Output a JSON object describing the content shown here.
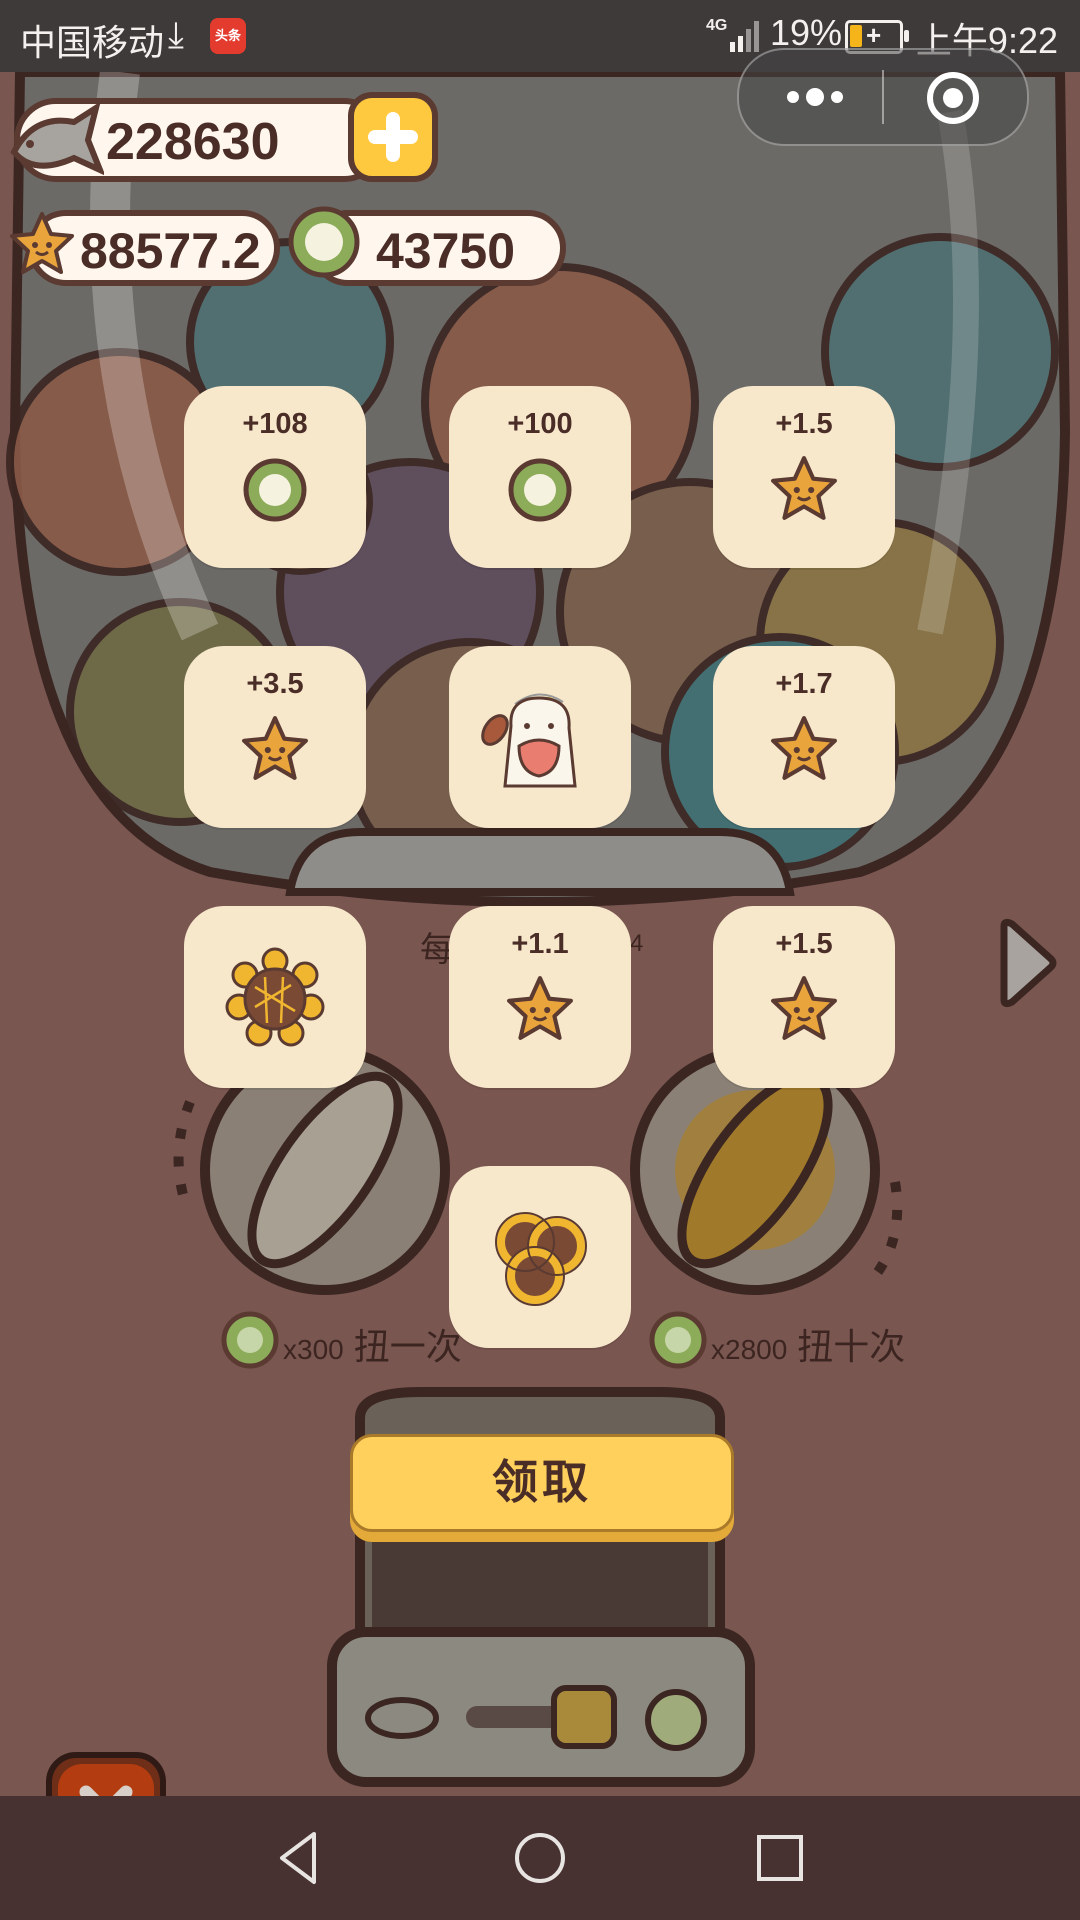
{
  "status_bar": {
    "carrier": "中国移动",
    "network": "4G",
    "battery_percent": "19%",
    "time": "上午9:22"
  },
  "currencies": {
    "fish": "228630",
    "stars": "88577.2",
    "coins": "43750"
  },
  "rewards": [
    {
      "type": "coin",
      "amount": "+108"
    },
    {
      "type": "coin",
      "amount": "+100"
    },
    {
      "type": "star",
      "amount": "+1.5"
    },
    {
      "type": "star",
      "amount": "+3.5"
    },
    {
      "type": "character",
      "amount": ""
    },
    {
      "type": "star",
      "amount": "+1.7"
    },
    {
      "type": "sunflower",
      "amount": ""
    },
    {
      "type": "star",
      "amount": "+1.1"
    },
    {
      "type": "star",
      "amount": "+1.5"
    },
    {
      "type": "sunflower-bunch",
      "amount": ""
    }
  ],
  "machine": {
    "partial_label_left": "每",
    "partial_label_right": "4"
  },
  "spin_options": [
    {
      "multiplier": "x300",
      "label": "扭一次"
    },
    {
      "multiplier": "x2800",
      "label": "扭十次"
    }
  ],
  "claim_label": "领取",
  "colors": {
    "background": "#7a5650",
    "card": "#f7e8cc",
    "button_yellow": "#ffd05b",
    "outline": "#5a3a31"
  }
}
